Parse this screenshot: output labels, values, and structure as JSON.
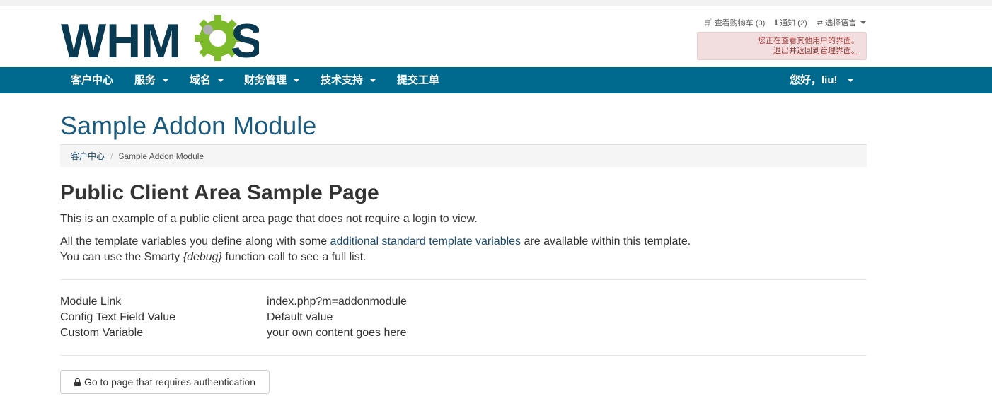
{
  "window": {
    "top_strip_text": ""
  },
  "brand": {
    "logo_text_a": "WHM",
    "logo_text_b": "S"
  },
  "top_links": {
    "cart": "查看购物车 (0)",
    "notifications": "通知 (2)",
    "language": "选择语言"
  },
  "admin_alert": {
    "line1": "您正在查看其他用户的界面。",
    "link": "退出并返回到管理界面。"
  },
  "nav": {
    "items": [
      "客户中心",
      "服务",
      "域名",
      "财务管理",
      "技术支持",
      "提交工单"
    ],
    "user": "您好，liu!"
  },
  "page": {
    "title": "Sample Addon Module",
    "breadcrumb": [
      "客户中心",
      "Sample Addon Module"
    ],
    "heading": "Public Client Area Sample Page",
    "intro": "This is an example of a public client area page that does not require a login to view.",
    "p2_before": "All the template variables you define along with some ",
    "p2_link": "additional standard template variables",
    "p2_after": " are available within this template.",
    "p3_before": "You can use the Smarty ",
    "p3_em": "{debug}",
    "p3_after": " function call to see a full list.",
    "details": [
      {
        "label": "Module Link",
        "value": "index.php?m=addonmodule"
      },
      {
        "label": "Config Text Field Value",
        "value": "Default value"
      },
      {
        "label": "Custom Variable",
        "value": "your own content goes here"
      }
    ],
    "auth_button": "Go to page that requires authentication"
  },
  "colors": {
    "nav_bg": "#006a8e",
    "title": "#1a5a7e",
    "logo_dark": "#0a3a52",
    "logo_green": "#7dbb2a"
  },
  "icons": [
    "cart-icon",
    "info-icon",
    "language-icon",
    "lock-icon",
    "gear-icon"
  ]
}
